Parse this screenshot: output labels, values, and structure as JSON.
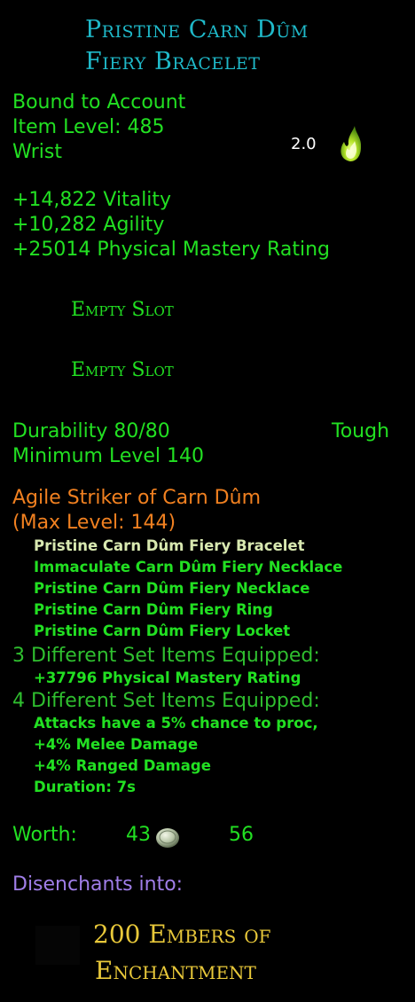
{
  "item": {
    "name_line1": "Pristine Carn Dûm",
    "name_line2": "Fiery Bracelet",
    "bind": "Bound to Account",
    "item_level": "Item Level: 485",
    "slot": "Wrist",
    "essence_value": "2.0",
    "stats": [
      "+14,822 Vitality",
      "+10,282 Agility",
      "+25014 Physical Mastery Rating"
    ],
    "empty_slots": [
      "Empty Slot",
      "Empty Slot"
    ],
    "durability": "Durability 80/80",
    "durability_type": "Tough",
    "min_level": "Minimum Level 140"
  },
  "set": {
    "name": "Agile Striker of Carn Dûm",
    "max_level": "(Max Level: 144)",
    "pieces": [
      "Pristine Carn Dûm Fiery Bracelet",
      "Immaculate Carn Dûm Fiery Necklace",
      "Pristine Carn Dûm Fiery Necklace",
      "Pristine Carn Dûm Fiery Ring",
      "Pristine Carn Dûm Fiery Locket"
    ],
    "bonus3_header": "3 Different Set Items Equipped:",
    "bonus3": [
      "+37796 Physical Mastery Rating"
    ],
    "bonus4_header": "4 Different Set Items Equipped:",
    "bonus4": [
      "Attacks have a 5% chance to proc,",
      "+4% Melee Damage",
      "+4% Ranged Damage",
      "Duration: 7s"
    ]
  },
  "worth": {
    "label": "Worth:",
    "silver": "43",
    "copper": "56"
  },
  "disenchant": {
    "label": "Disenchants into:",
    "result_line1": "200 Embers of",
    "result_line2": "Enchantment"
  },
  "icons": {
    "essence": "green-flame-icon",
    "silver": "silver-coin-icon",
    "ember": "ember-icon"
  },
  "colors": {
    "title": "#1fb9c9",
    "stat": "#22e022",
    "set": "#f08020",
    "disenchant": "#a07ee8",
    "result": "#e8c83a"
  }
}
